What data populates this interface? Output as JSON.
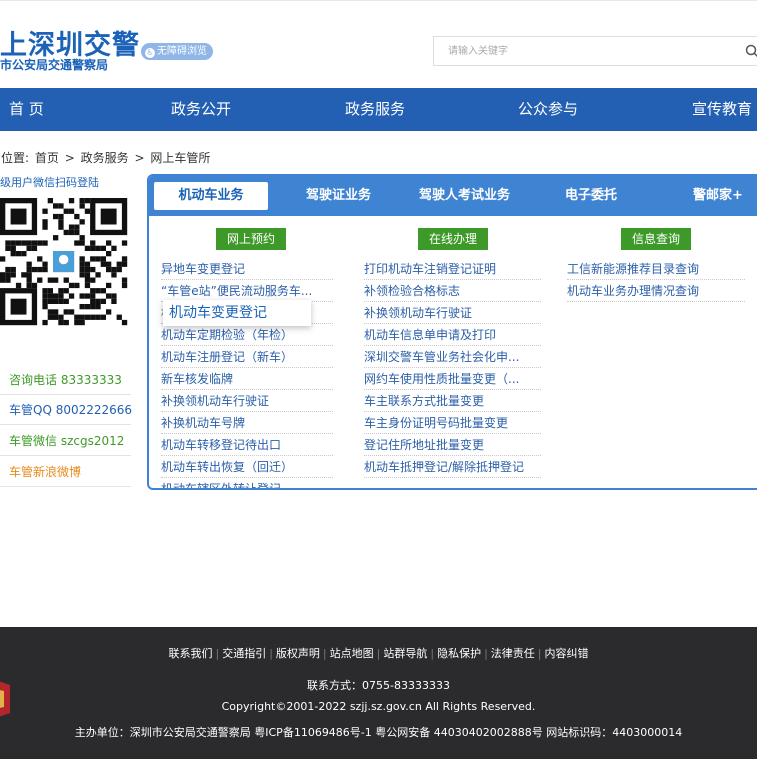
{
  "header": {
    "logo_main": "上深圳交警",
    "logo_sub": "市公安局交通警察局",
    "accessibility": "无障碍浏览",
    "search_placeholder": "请输入关键字"
  },
  "nav": [
    "首 页",
    "政务公开",
    "政务服务",
    "公众参与",
    "宣传教育"
  ],
  "breadcrumb": {
    "prefix": "位置:",
    "items": [
      "首页",
      "政务服务",
      "网上车管所"
    ],
    "sep": ">"
  },
  "sidebar": {
    "title": "级用户微信扫码登陆",
    "rows": [
      {
        "label": "咨询电话 83333333",
        "color": "#3e9a28"
      },
      {
        "label": "车管QQ 8002222666",
        "color": "#2360b3"
      },
      {
        "label": "车管微信 szcgs2012",
        "color": "#3e9a28"
      },
      {
        "label": "车管新浪微博",
        "color": "#e88a1a"
      }
    ]
  },
  "panel": {
    "tabs": [
      "机动车业务",
      "驾驶证业务",
      "驾驶人考试业务",
      "电子委托",
      "警邮家+"
    ],
    "categories": [
      "网上预约",
      "在线办理",
      "信息查询"
    ],
    "col1": [
      "异地车变更登记",
      "“车管e站”便民流动服务车...",
      "机动车变更登记",
      "机动车定期检验（年检）",
      "机动车注册登记（新车）",
      "新车核发临牌",
      "补换领机动车行驶证",
      "补换机动车号牌",
      "机动车转移登记待出口",
      "机动车转出恢复（回迁）",
      "机动车辖区外转让登记"
    ],
    "col2": [
      "打印机动车注销登记证明",
      "补领检验合格标志",
      "补换领机动车行驶证",
      "机动车信息单申请及打印",
      "深圳交警车管业务社会化申...",
      "网约车使用性质批量变更（...",
      "车主联系方式批量变更",
      "车主身份证明号码批量变更",
      "登记住所地址批量变更",
      "机动车抵押登记/解除抵押登记"
    ],
    "col3": [
      "工信新能源推荐目录查询",
      "机动车业务办理情况查询"
    ],
    "tooltip": "机动车变更登记"
  },
  "footer": {
    "links": [
      "联系我们",
      "交通指引",
      "版权声明",
      "站点地图",
      "站群导航",
      "隐私保护",
      "法律责任",
      "内容纠错"
    ],
    "contact": "联系方式：0755-83333333",
    "copyright": "Copyright©2001-2022 szjj.sz.gov.cn   All Rights Reserved.",
    "host": "主办单位：深圳市公安局交通警察局  粤ICP备11069486号-1  粤公网安备 44030402002888号  网站标识码：4403000014"
  },
  "colors": {
    "brand": "#2360b3",
    "tab_bar": "#3f83d3",
    "category": "#3e9a28",
    "footer": "#2b2b2e"
  }
}
